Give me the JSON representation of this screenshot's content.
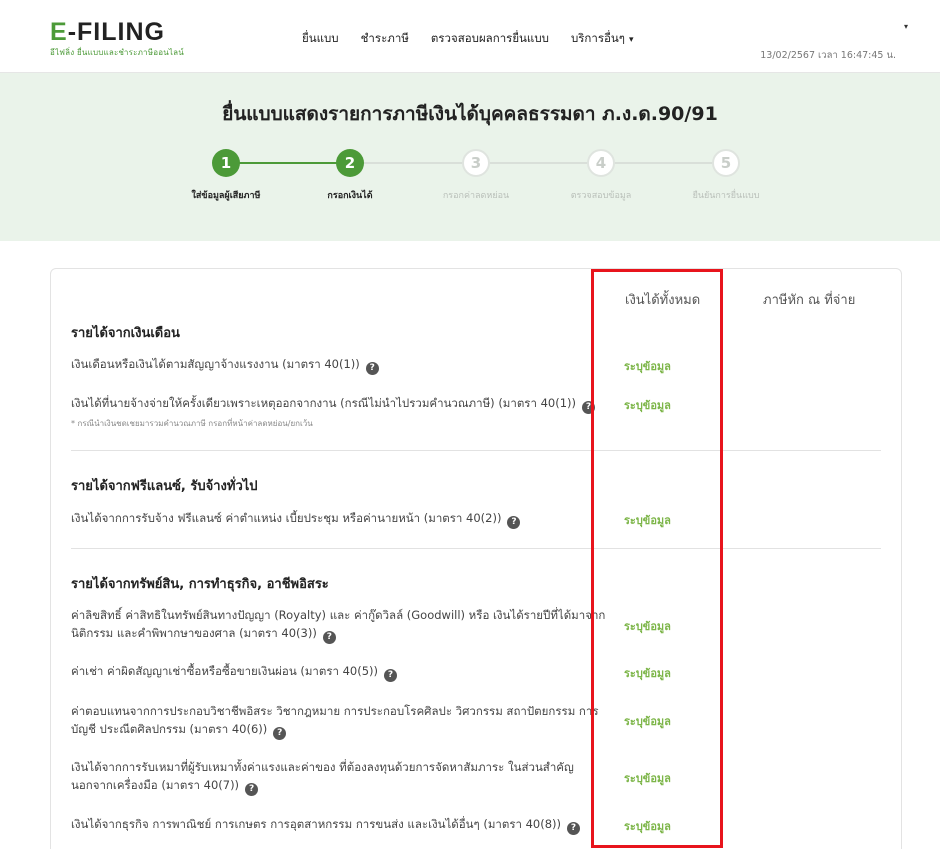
{
  "brand": {
    "logo_text_prefix": "E",
    "logo_text_rest": "-FILING",
    "logo_subtitle": "อีไฟลิ่ง ยื่นแบบและชำระภาษีออนไลน์"
  },
  "nav": {
    "items": [
      "ยื่นแบบ",
      "ชำระภาษี",
      "ตรวจสอบผลการยื่นแบบ",
      "บริการอื่นๆ"
    ],
    "user_caret": "▾",
    "datetime": "13/02/2567 เวลา 16:47:45 น."
  },
  "page": {
    "title": "ยื่นแบบแสดงรายการภาษีเงินได้บุคคลธรรมดา ภ.ง.ด.90/91"
  },
  "steps": [
    {
      "number": "1",
      "label": "ใส่ข้อมูลผู้เสียภาษี",
      "state": "done"
    },
    {
      "number": "2",
      "label": "กรอกเงินได้",
      "state": "current"
    },
    {
      "number": "3",
      "label": "กรอกค่าลดหย่อน",
      "state": "todo"
    },
    {
      "number": "4",
      "label": "ตรวจสอบข้อมูล",
      "state": "todo"
    },
    {
      "number": "5",
      "label": "ยืนยันการยื่นแบบ",
      "state": "todo"
    }
  ],
  "table": {
    "col_total": "เงินได้ทั้งหมด",
    "col_withheld": "ภาษีหัก ณ ที่จ่าย",
    "entry_label": "ระบุข้อมูล",
    "help_symbol": "?",
    "sections": [
      {
        "title": "รายได้จากเงินเดือน",
        "rows": [
          {
            "text": "เงินเดือนหรือเงินได้ตามสัญญาจ้างแรงงาน (มาตรา 40(1))"
          },
          {
            "text": "เงินได้ที่นายจ้างจ่ายให้ครั้งเดียวเพราะเหตุออกจากงาน (กรณีไม่นำไปรวมคำนวณภาษี) (มาตรา 40(1))",
            "note": "* กรณีนำเงินชดเชยมารวมคำนวณภาษี กรอกที่หน้าค่าลดหย่อน/ยกเว้น"
          }
        ]
      },
      {
        "title": "รายได้จากฟรีแลนซ์, รับจ้างทั่วไป",
        "rows": [
          {
            "text": "เงินได้จากการรับจ้าง ฟรีแลนซ์ ค่าตำแหน่ง เบี้ยประชุม หรือค่านายหน้า (มาตรา 40(2))"
          }
        ]
      },
      {
        "title": "รายได้จากทรัพย์สิน, การทำธุรกิจ, อาชีพอิสระ",
        "rows": [
          {
            "text": "ค่าลิขสิทธิ์ ค่าสิทธิในทรัพย์สินทางปัญญา (Royalty) และ ค่ากู๊ดวิลล์ (Goodwill) หรือ เงินได้รายปีที่ได้มาจากนิติกรรม และคำพิพากษาของศาล (มาตรา 40(3))"
          },
          {
            "text": "ค่าเช่า ค่าผิดสัญญาเช่าซื้อหรือซื้อขายเงินผ่อน (มาตรา 40(5))"
          },
          {
            "text": "ค่าตอบแทนจากการประกอบวิชาชีพอิสระ วิชากฎหมาย การประกอบโรคศิลปะ วิศวกรรม สถาปัตยกรรม การบัญชี ประณีตศิลปกรรม (มาตรา 40(6))"
          },
          {
            "text": "เงินได้จากการรับเหมาที่ผู้รับเหมาทั้งค่าแรงและค่าของ ที่ต้องลงทุนด้วยการจัดหาสัมภาระ ในส่วนสำคัญนอกจากเครื่องมือ (มาตรา 40(7))"
          },
          {
            "text": "เงินได้จากธุรกิจ การพาณิชย์ การเกษตร การอุตสาหกรรม การขนส่ง และเงินได้อื่นๆ (มาตรา 40(8))"
          }
        ]
      }
    ]
  },
  "colors": {
    "brand_green": "#4c9a38",
    "entry_green": "#7cb548",
    "hero_bg": "#eaf3ea",
    "highlight_red": "#e8141c"
  }
}
